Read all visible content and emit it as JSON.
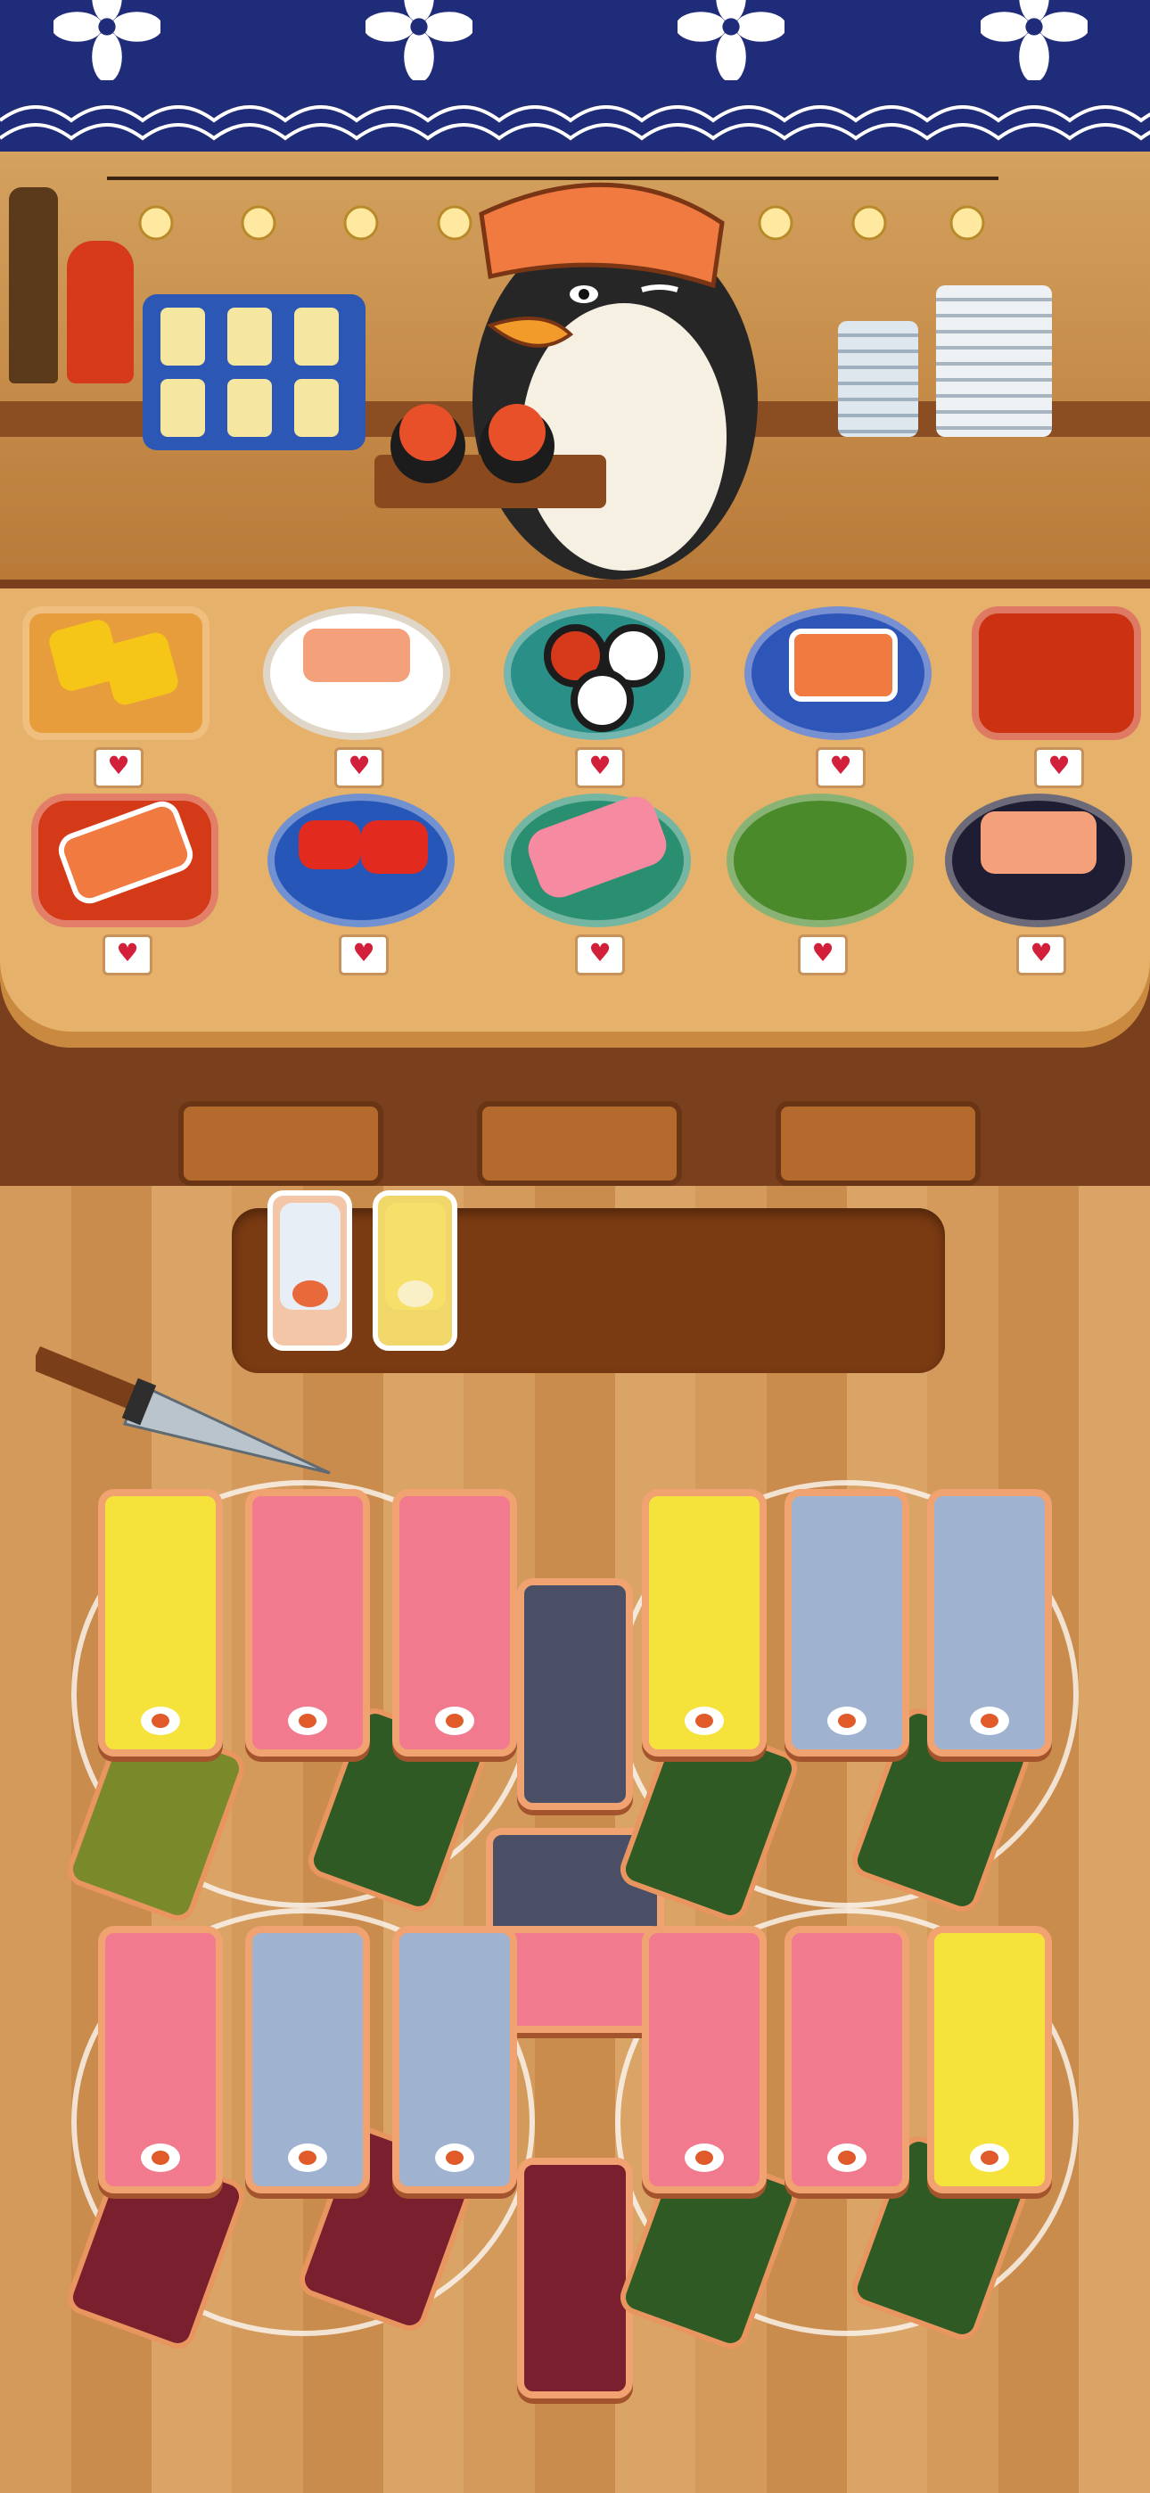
{
  "theme": {
    "banner_color": "#1f2c7a",
    "heart_color": "#d2203a",
    "tray_color": "#7a3a12"
  },
  "counter": {
    "orders": [
      {
        "plate": "tamago-plate",
        "heart": "♥"
      },
      {
        "plate": "salmon-plate",
        "heart": "♥"
      },
      {
        "plate": "ikura-maki-plate",
        "heart": "♥"
      },
      {
        "plate": "salmon-roll-plate",
        "heart": "♥"
      },
      {
        "plate": "empty-red-plate",
        "heart": "♥"
      },
      {
        "plate": "salmon-nigiri-plate",
        "heart": "♥"
      },
      {
        "plate": "tuna-nigiri-plate",
        "heart": "♥"
      },
      {
        "plate": "tuna-roll-plate",
        "heart": "♥"
      },
      {
        "plate": "empty-green-plate",
        "heart": "♥"
      },
      {
        "plate": "salmon-bowl",
        "heart": "♥"
      }
    ]
  },
  "tray": {
    "slots": [
      {
        "item": "silver-roll-piece"
      },
      {
        "item": "tamago-roll-piece"
      }
    ]
  },
  "board": {
    "roll_colors": {
      "tamago": "#f5e23a",
      "tuna": "#f27a8f",
      "silver": "#9fb2cf",
      "nori": "#2f5a24",
      "dark": "#4a4f66",
      "maroon": "#7a1f2e"
    }
  }
}
